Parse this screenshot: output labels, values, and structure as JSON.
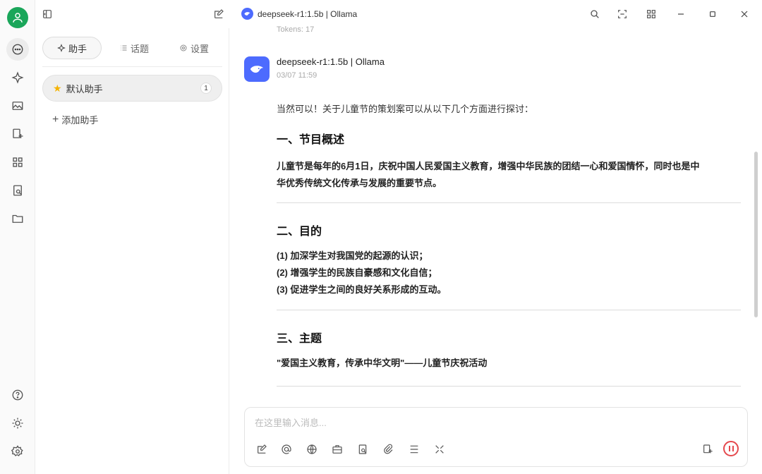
{
  "titlebar": {
    "model_title": "deepseek-r1:1.5b | Ollama",
    "icons": [
      "toggle-sidebar-icon",
      "new-chat-icon",
      "search-icon",
      "screenshot-icon",
      "layout-grid-icon",
      "minimize-icon",
      "maximize-icon",
      "close-icon"
    ]
  },
  "rail": {
    "accent_color": "#1aa65a",
    "icons": [
      "user-icon",
      "chat-icon",
      "sparkle-icon",
      "image-icon",
      "translate-icon",
      "apps-icon",
      "notes-icon",
      "folder-icon",
      "help-icon",
      "theme-icon",
      "settings-icon"
    ]
  },
  "panel": {
    "tabs": [
      {
        "label": "助手",
        "icon": "sparkle-icon"
      },
      {
        "label": "话题",
        "icon": "list-icon"
      },
      {
        "label": "设置",
        "icon": "gear-icon"
      }
    ],
    "assistants": [
      {
        "label": "默认助手",
        "badge": "1"
      }
    ],
    "add_label": "添加助手"
  },
  "chat": {
    "top_fragment": "Tokens: 17",
    "brand_color": "#4d6bfe",
    "message": {
      "name": "deepseek-r1:1.5b | Ollama",
      "time": "03/07 11:59",
      "intro": "当然可以！关于儿童节的策划案可以从以下几个方面进行探讨：",
      "sections": [
        {
          "heading": "一、节目概述",
          "lines": [
            "儿童节是每年的6月1日，庆祝中国人民爱国主义教育，增强中华民族的团结一心和爱国情怀，同时也是中",
            "华优秀传统文化传承与发展的重要节点。"
          ]
        },
        {
          "heading": "二、目的",
          "lines": [
            "(1) 加深学生对我国党的起源的认识；",
            "(2) 增强学生的民族自豪感和文化自信；",
            "(3) 促进学生之间的良好关系形成的互动。"
          ]
        },
        {
          "heading": "三、主题",
          "lines": [
            "\"爱国主义教育，传承中华文明\"——儿童节庆祝活动"
          ]
        }
      ]
    },
    "input": {
      "placeholder": "在这里输入消息..."
    },
    "toolbar_icons": [
      "edit-icon",
      "mention-icon",
      "globe-icon",
      "briefcase-icon",
      "document-icon",
      "attachment-icon",
      "divider-icon",
      "expand-icon",
      "add-image-icon",
      "stop-icon"
    ],
    "stop_color": "#e5484d"
  }
}
